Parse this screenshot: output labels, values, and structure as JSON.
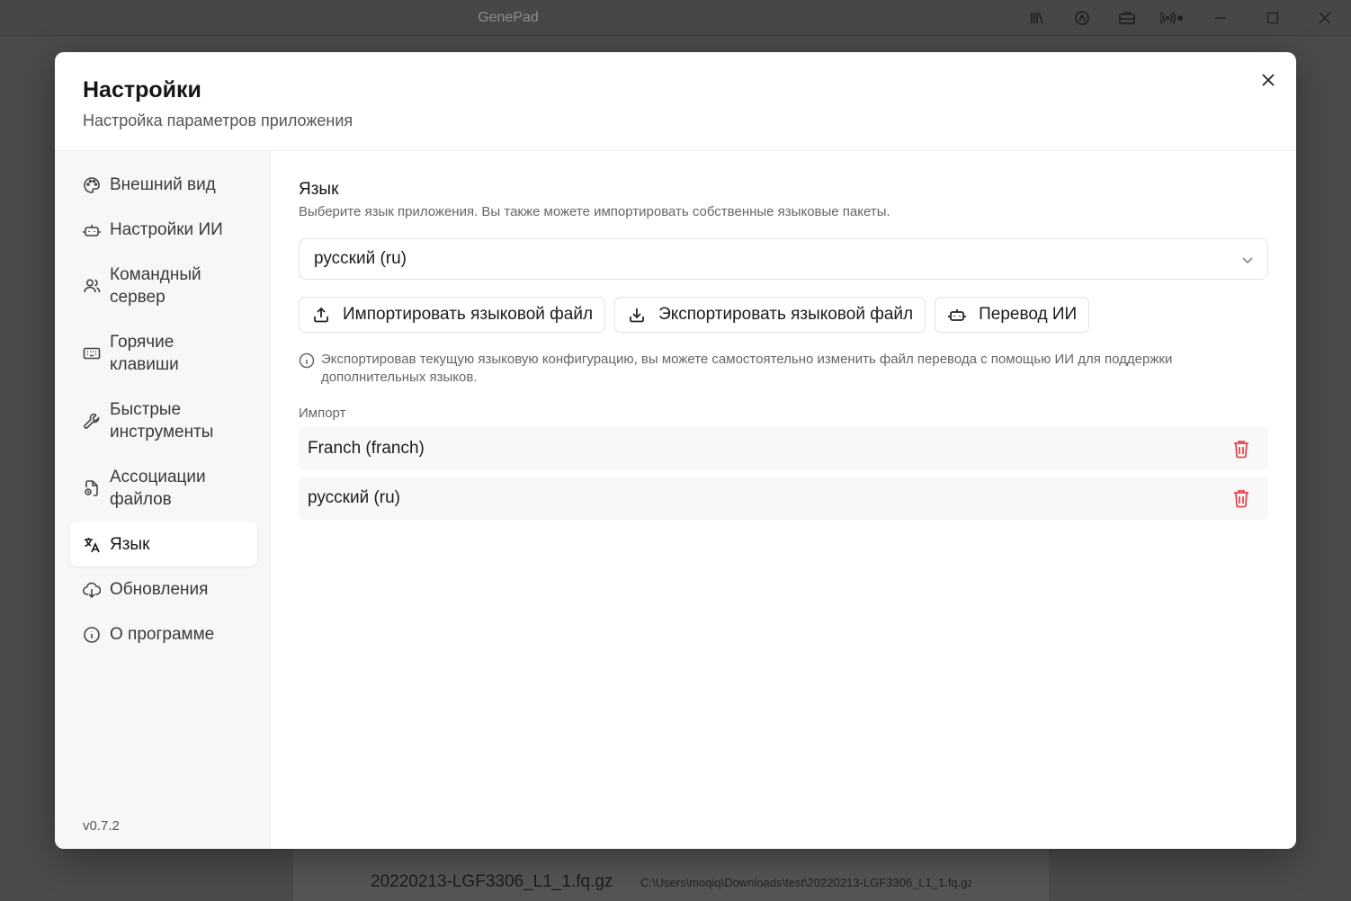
{
  "window": {
    "title": "GenePad"
  },
  "background": {
    "file_name": "20220213-LGF3306_L1_1.fq.gz",
    "file_path": "C:\\Users\\moqiq\\Downloads\\test\\20220213-LGF3306_L1_1.fq.gz"
  },
  "modal": {
    "title": "Настройки",
    "subtitle": "Настройка параметров приложения"
  },
  "sidebar": {
    "items": [
      {
        "label": "Внешний вид",
        "icon": "palette-icon"
      },
      {
        "label": "Настройки ИИ",
        "icon": "robot-icon"
      },
      {
        "label": "Командный сервер",
        "icon": "users-icon"
      },
      {
        "label": "Горячие клавиши",
        "icon": "keyboard-icon"
      },
      {
        "label": "Быстрые инструменты",
        "icon": "wrench-icon"
      },
      {
        "label": "Ассоциации файлов",
        "icon": "file-link-icon"
      },
      {
        "label": "Язык",
        "icon": "language-icon",
        "active": true
      },
      {
        "label": "Обновления",
        "icon": "cloud-download-icon"
      },
      {
        "label": "О программе",
        "icon": "info-icon"
      }
    ],
    "version": "v0.7.2"
  },
  "language": {
    "title": "Язык",
    "description": "Выберите язык приложения. Вы также можете импортировать собственные языковые пакеты.",
    "selected": "русский (ru)",
    "buttons": {
      "import": "Импортировать языковой файл",
      "export": "Экспортировать языковой файл",
      "ai_translate": "Перевод ИИ"
    },
    "note": "Экспортировав текущую языковую конфигурацию, вы можете самостоятельно изменить файл перевода с помощью ИИ для поддержки дополнительных языков.",
    "import_label": "Импорт",
    "imported": [
      "Franch (franch)",
      "русский (ru)"
    ]
  },
  "colors": {
    "danger": "#e5484d",
    "sidebar_bg": "#f7f7f8"
  }
}
